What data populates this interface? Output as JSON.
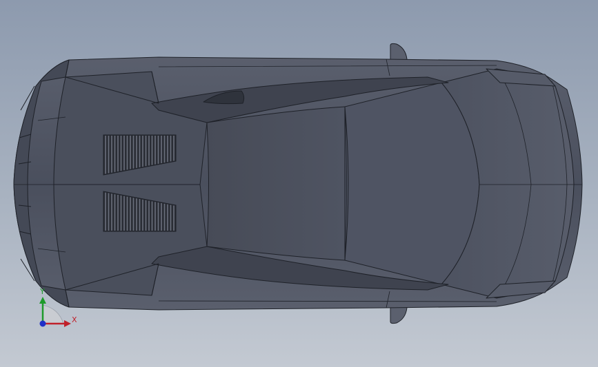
{
  "viewport": {
    "model": "sports-car-top-view",
    "view": "top",
    "colors": {
      "background_top": "#8d9aae",
      "background_bottom": "#c3c9d2",
      "body": "#4c5160",
      "body_dark": "#3d414d",
      "body_light": "#5a5f6d",
      "edge": "#1e2128"
    }
  },
  "triad": {
    "x_label": "X",
    "y_label": "Y",
    "x_color": "#c0202a",
    "y_color": "#1e9a2a",
    "z_color": "#1f2fc8"
  }
}
